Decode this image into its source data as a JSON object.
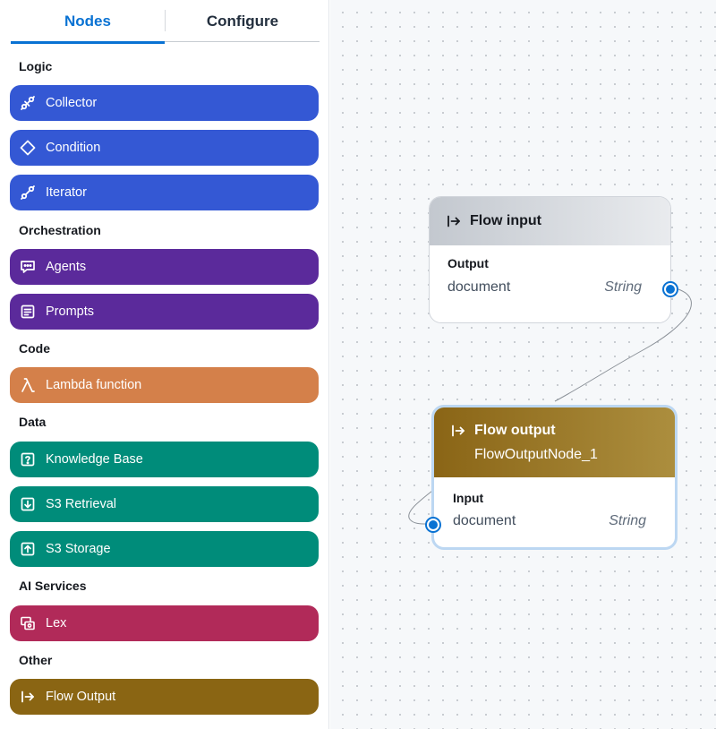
{
  "tabs": {
    "nodes": "Nodes",
    "configure": "Configure"
  },
  "sections": {
    "logic": "Logic",
    "orchestration": "Orchestration",
    "code": "Code",
    "data": "Data",
    "ai_services": "AI Services",
    "other": "Other"
  },
  "nodes": {
    "collector": {
      "label": "Collector",
      "icon": "collector-icon",
      "color": "#3458d4"
    },
    "condition": {
      "label": "Condition",
      "icon": "condition-icon",
      "color": "#3458d4"
    },
    "iterator": {
      "label": "Iterator",
      "icon": "iterator-icon",
      "color": "#3458d4"
    },
    "agents": {
      "label": "Agents",
      "icon": "agents-icon",
      "color": "#5b2a9b"
    },
    "prompts": {
      "label": "Prompts",
      "icon": "prompts-icon",
      "color": "#5b2a9b"
    },
    "lambda": {
      "label": "Lambda function",
      "icon": "lambda-icon",
      "color": "#d4804a"
    },
    "knowledge_base": {
      "label": "Knowledge Base",
      "icon": "knowledge-base-icon",
      "color": "#008c7a"
    },
    "s3_retrieval": {
      "label": "S3 Retrieval",
      "icon": "s3-retrieval-icon",
      "color": "#008c7a"
    },
    "s3_storage": {
      "label": "S3 Storage",
      "icon": "s3-storage-icon",
      "color": "#008c7a"
    },
    "lex": {
      "label": "Lex",
      "icon": "lex-icon",
      "color": "#b12a59"
    },
    "flow_output": {
      "label": "Flow Output",
      "icon": "flow-output-icon",
      "color": "#8a6513"
    }
  },
  "canvas": {
    "flow_input": {
      "title": "Flow input",
      "port_section": "Output",
      "port_name": "document",
      "port_type": "String"
    },
    "flow_output": {
      "title": "Flow output",
      "subtitle": "FlowOutputNode_1",
      "port_section": "Input",
      "port_name": "document",
      "port_type": "String"
    }
  },
  "colors": {
    "accent": "#0972d3"
  }
}
